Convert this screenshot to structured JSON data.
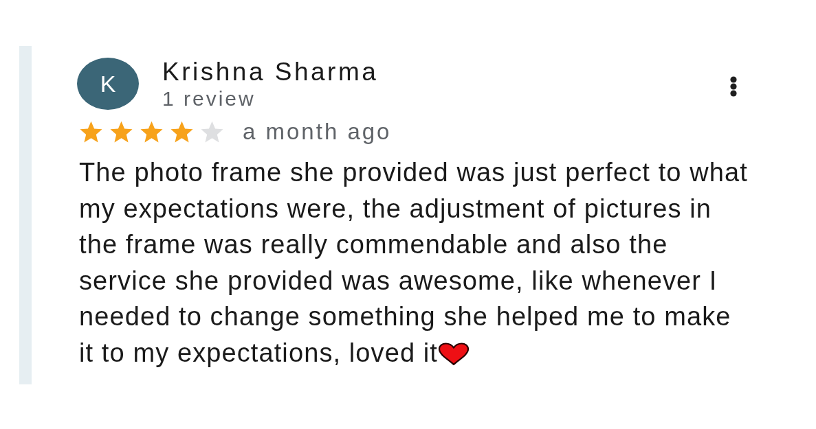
{
  "review": {
    "author": {
      "initial": "K",
      "name": "Krishna Sharma",
      "review_count": "1 review"
    },
    "stars": 4,
    "time": "a month ago",
    "text": "The photo frame she provided was just perfect to what my expectations were, the adjustment of pictures in the frame was really commendable and also the service she provided was awesome, like whenever I needed to change something she helped me to make it to my expectations, loved it"
  }
}
